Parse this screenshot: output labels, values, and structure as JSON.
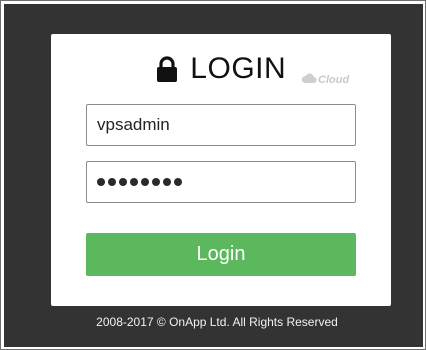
{
  "login": {
    "title": "LOGIN",
    "lock_icon": "lock-icon",
    "brand_text": "Cloud",
    "username": {
      "value": "vpsadmin"
    },
    "password": {
      "masked_length": 8
    },
    "button_label": "Login"
  },
  "footer": {
    "copyright": "2008-2017 © OnApp Ltd. All Rights Reserved"
  },
  "colors": {
    "backdrop": "#333333",
    "card": "#ffffff",
    "button": "#5cb85c",
    "button_text": "#ffffff",
    "footer_text": "#f2f2f2"
  }
}
